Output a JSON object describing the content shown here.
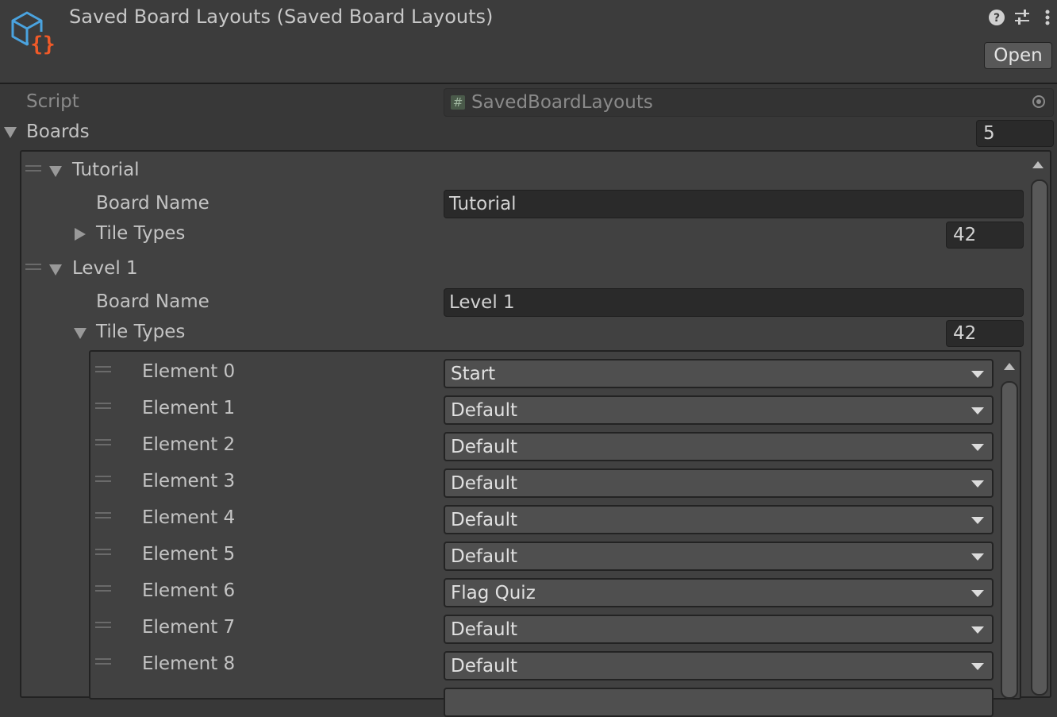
{
  "header": {
    "title": "Saved Board Layouts (Saved Board Layouts)",
    "icons": [
      "asset-scriptable-object-icon",
      "help-icon",
      "preset-sliders-icon",
      "kebab-menu-icon"
    ],
    "open_label": "Open"
  },
  "script_row": {
    "label": "Script",
    "value": "SavedBoardLayouts",
    "icon": "csharp-hash-icon"
  },
  "boards": {
    "label": "Boards",
    "count": "5",
    "items": [
      {
        "title": "Tutorial",
        "board_name_label": "Board Name",
        "board_name": "Tutorial",
        "tile_types_label": "Tile Types",
        "tile_types_count": "42"
      },
      {
        "title": "Level 1",
        "board_name_label": "Board Name",
        "board_name": "Level 1",
        "tile_types_label": "Tile Types",
        "tile_types_count": "42",
        "elements": [
          {
            "label": "Element 0",
            "value": "Start"
          },
          {
            "label": "Element 1",
            "value": "Default"
          },
          {
            "label": "Element 2",
            "value": "Default"
          },
          {
            "label": "Element 3",
            "value": "Default"
          },
          {
            "label": "Element 4",
            "value": "Default"
          },
          {
            "label": "Element 5",
            "value": "Default"
          },
          {
            "label": "Element 6",
            "value": "Flag Quiz"
          },
          {
            "label": "Element 7",
            "value": "Default"
          },
          {
            "label": "Element 8",
            "value": "Default"
          }
        ]
      }
    ]
  },
  "colors": {
    "background": "#383838",
    "header": "#3c3c3c",
    "icon_blue": "#4aa3df",
    "icon_orange": "#f05a28"
  }
}
